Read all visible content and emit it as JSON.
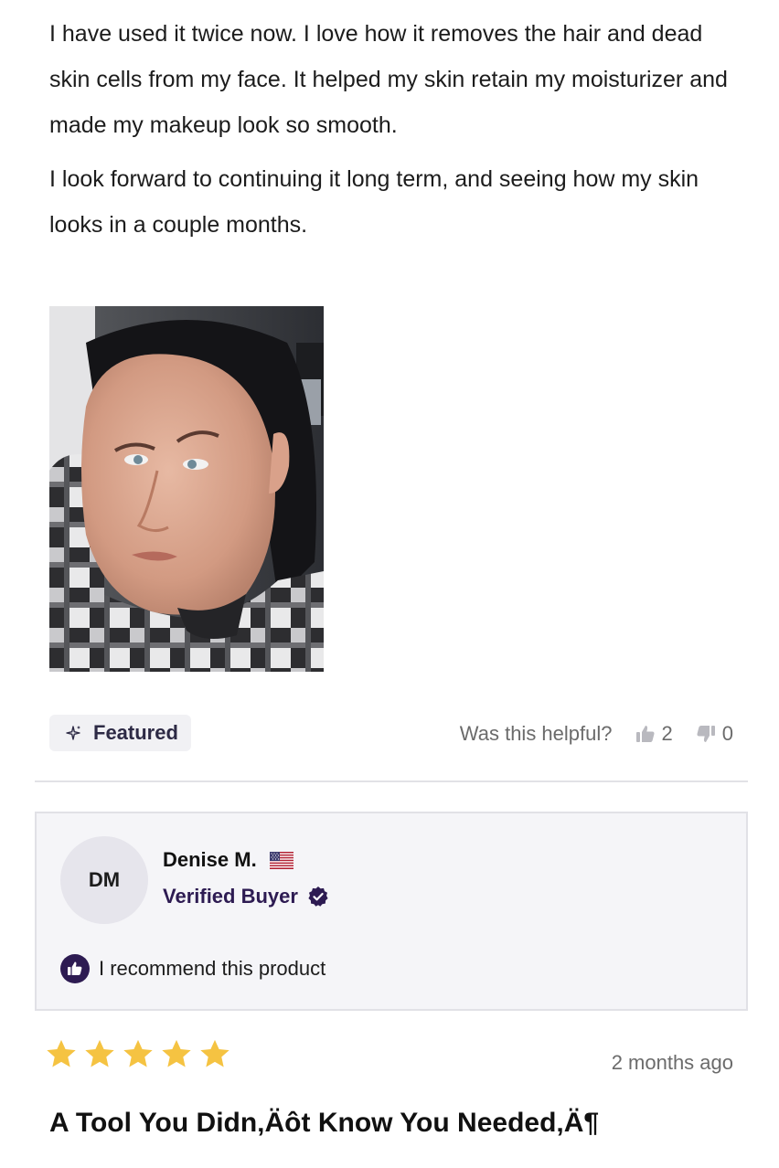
{
  "review_body": {
    "paragraphs": [
      "I have used it twice now. I love how it removes the hair and dead skin cells from my face. It helped my skin retain my moisturizer and made my makeup look so smooth.",
      "I look forward to continuing it long term, and seeing how my skin looks in a couple months."
    ]
  },
  "photo": {
    "icon": "customer-photo"
  },
  "featured": {
    "label": "Featured",
    "icon": "sparkle-icon"
  },
  "helpful": {
    "question": "Was this helpful?",
    "up_count": "2",
    "down_count": "0"
  },
  "author": {
    "initials": "DM",
    "name": "Denise M.",
    "country_icon": "us-flag-icon",
    "badge": "Verified Buyer",
    "recommend_text": "I recommend this product"
  },
  "next_review": {
    "rating": 5,
    "max_rating": 5,
    "date": "2 months ago",
    "title": "A Tool You Didn‚Äôt Know You Needed‚Ä¶"
  },
  "colors": {
    "star": "#f5c342",
    "brand_dark": "#2d1b52",
    "card_bg": "#f5f5f8",
    "muted_text": "#6b6b6b"
  }
}
